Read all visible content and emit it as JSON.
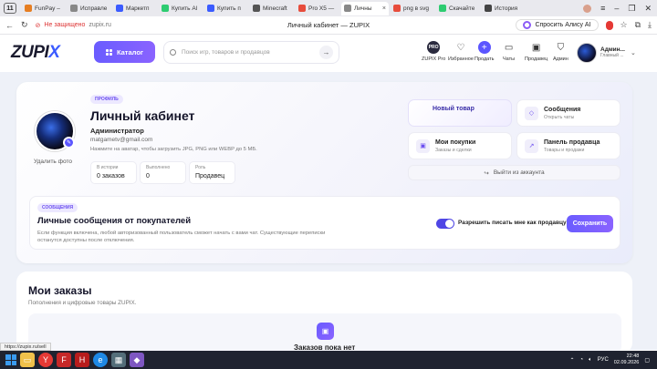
{
  "browser": {
    "tab_count": "11",
    "tabs": [
      {
        "label": "FunPay – ",
        "color": "#e67e22"
      },
      {
        "label": "Исправле",
        "color": "#888888"
      },
      {
        "label": "Маркетп",
        "color": "#3b5bff"
      },
      {
        "label": "Купить Al",
        "color": "#2ecc71"
      },
      {
        "label": "Купить п",
        "color": "#3b5bff"
      },
      {
        "label": "Minecraft",
        "color": "#555555"
      },
      {
        "label": "Pro X5 — ",
        "color": "#e74c3c"
      },
      {
        "label": "Личны",
        "color": "#888888"
      },
      {
        "label": "png в svg",
        "color": "#e74c3c"
      },
      {
        "label": "Скачайте",
        "color": "#2ecc71"
      },
      {
        "label": "История",
        "color": "#444444"
      }
    ],
    "active_tab_index": 7,
    "insecure_label": "Не защищено",
    "url": "zupix.ru",
    "page_title": "Личный кабинет — ZUPIX",
    "alice_label": "Спросить Алису AI"
  },
  "header": {
    "logo_main": "ZUPI",
    "logo_accent": "X",
    "catalog_label": "Каталог",
    "search_placeholder": "Поиск игр, товаров и продавцов",
    "nav": [
      {
        "label": "ZUPIX Pro",
        "icon": "pro-badge"
      },
      {
        "label": "Избранное",
        "icon": "heart-icon"
      },
      {
        "label": "Продать",
        "icon": "plus-icon"
      },
      {
        "label": "Чаты",
        "icon": "chat-icon"
      },
      {
        "label": "Продавец",
        "icon": "bag-icon"
      },
      {
        "label": "Админ",
        "icon": "shield-icon"
      }
    ],
    "pro_badge_text": "PRO",
    "user_name": "Админ...",
    "user_role": "Главный ..."
  },
  "profile": {
    "chip": "ПРОФИЛЬ",
    "title": "Личный кабинет",
    "role": "Администратор",
    "email": "matgametv@gmail.com",
    "avatar_hint": "Нажмите на аватар, чтобы загрузить JPG, PNG или WEBP до 5 МБ.",
    "delete_photo": "Удалить фото",
    "stats": [
      {
        "label": "В истории",
        "value": "0 заказов"
      },
      {
        "label": "Выполнено",
        "value": "0"
      },
      {
        "label": "Роль",
        "value": "Продавец"
      }
    ]
  },
  "quick_actions": {
    "new_item": "Новый товар",
    "messages_title": "Сообщения",
    "messages_sub": "Открыть чаты",
    "purchases_title": "Мои покупки",
    "purchases_sub": "Заказы и сделки",
    "seller_title": "Панель продавца",
    "seller_sub": "Товары и продажи",
    "logout": "Выйти из аккаунта"
  },
  "messages_section": {
    "chip": "СООБЩЕНИЯ",
    "title": "Личные сообщения от покупателей",
    "description": "Если функция включена, любой авторизованный пользователь сможет начать с вами чат. Существующие переписки останутся доступны после отключения.",
    "toggle_label": "Разрешить писать мне как продавцу",
    "toggle_on": true,
    "save_label": "Сохранить"
  },
  "orders": {
    "title": "Мои заказы",
    "subtitle": "Пополнения и цифровые товары ZUPIX.",
    "empty_text": "Заказов пока нет"
  },
  "status_url": "https://zupix.ru/sell",
  "taskbar": {
    "lang": "РУС",
    "time": "22:48",
    "date": "02.09.2026"
  }
}
